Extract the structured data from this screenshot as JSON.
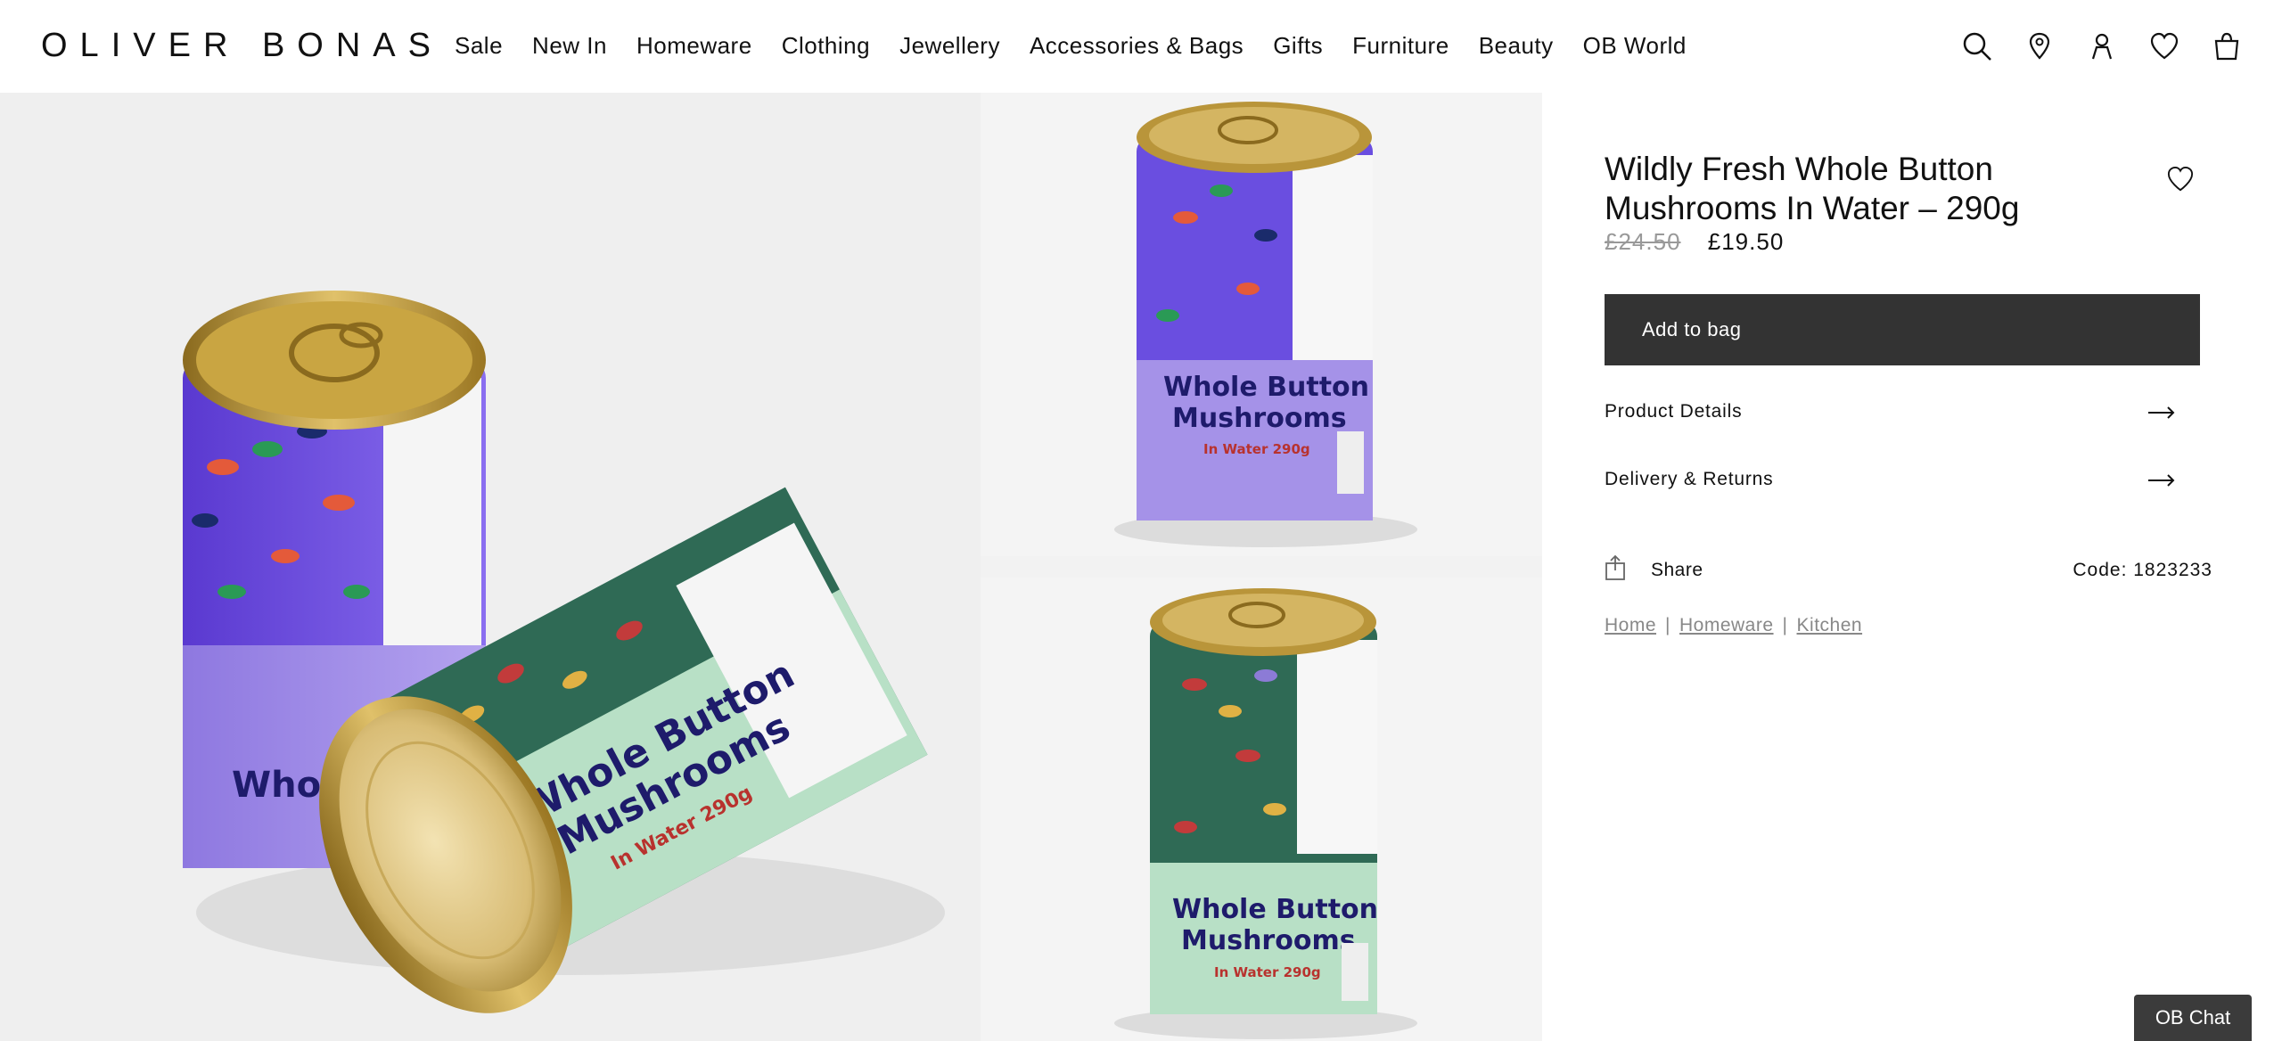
{
  "brand": {
    "logo": "OLIVER BONAS"
  },
  "nav": [
    {
      "label": "Sale"
    },
    {
      "label": "New In"
    },
    {
      "label": "Homeware"
    },
    {
      "label": "Clothing"
    },
    {
      "label": "Jewellery"
    },
    {
      "label": "Accessories & Bags"
    },
    {
      "label": "Gifts"
    },
    {
      "label": "Furniture"
    },
    {
      "label": "Beauty"
    },
    {
      "label": "OB World"
    }
  ],
  "header_icons": [
    "search-icon",
    "store-locator-icon",
    "account-icon",
    "wishlist-icon",
    "bag-icon"
  ],
  "product": {
    "title": "Wildly Fresh Whole Button Mushrooms In Water – 290g",
    "old_price": "£24.50",
    "price": "£19.50",
    "add_to_bag": "Add to bag",
    "accordions": [
      {
        "label": "Product Details"
      },
      {
        "label": "Delivery & Returns"
      }
    ],
    "share": "Share",
    "code": "Code: 1823233"
  },
  "breadcrumb": [
    {
      "label": "Home"
    },
    {
      "label": "Homeware"
    },
    {
      "label": "Kitchen"
    }
  ],
  "tins": {
    "line1": "Whole Button",
    "line2": "Mushrooms",
    "line3": "In Water 290g"
  },
  "chat": {
    "label": "OB Chat"
  },
  "colors": {
    "purple": "#7b5ce6",
    "lavender": "#a592e8",
    "green_band": "#2f6a55",
    "mint": "#b8e0c6",
    "gold": "#c8a23a",
    "button": "#333333"
  }
}
